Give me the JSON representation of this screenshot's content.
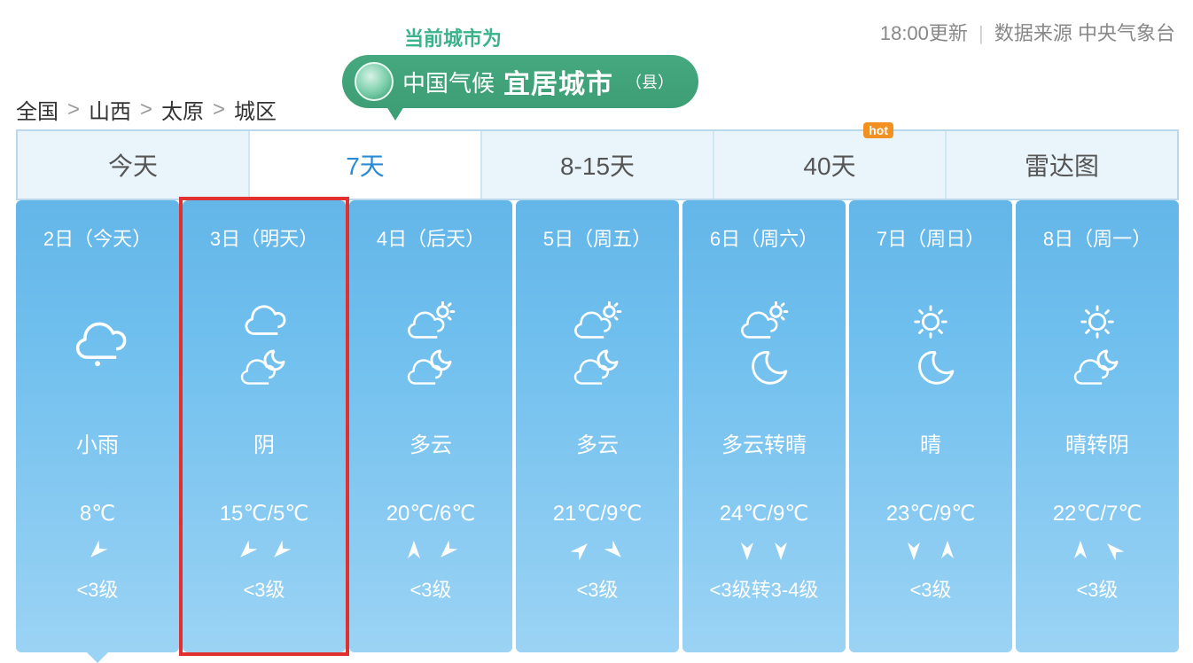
{
  "header": {
    "update_time": "18:00更新",
    "source_label": "数据来源 中央气象台"
  },
  "breadcrumb": {
    "items": [
      "全国",
      "山西",
      "太原",
      "城区"
    ]
  },
  "city_badge": {
    "caption": "当前城市为",
    "prefix": "中国气候",
    "strong": "宜居城市",
    "suffix": "（县）"
  },
  "tabs": {
    "items": [
      {
        "label": "今天",
        "active": false
      },
      {
        "label": "7天",
        "active": true
      },
      {
        "label": "8-15天",
        "active": false
      },
      {
        "label": "40天",
        "active": false,
        "hot": "hot"
      },
      {
        "label": "雷达图",
        "active": false
      }
    ]
  },
  "forecast": [
    {
      "date": "2日（今天）",
      "day_icon": "rain-light",
      "night_icon": null,
      "condition": "小雨",
      "temp": "8℃",
      "wind_arrows": [
        "sw"
      ],
      "wind": "<3级",
      "first": true
    },
    {
      "date": "3日（明天）",
      "day_icon": "overcast",
      "night_icon": "cloudy-night",
      "condition": "阴",
      "temp": "15℃/5℃",
      "wind_arrows": [
        "sw",
        "sw"
      ],
      "wind": "<3级",
      "highlighted": true
    },
    {
      "date": "4日（后天）",
      "day_icon": "cloudy-day",
      "night_icon": "cloudy-night",
      "condition": "多云",
      "temp": "20℃/6℃",
      "wind_arrows": [
        "n",
        "sw"
      ],
      "wind": "<3级"
    },
    {
      "date": "5日（周五）",
      "day_icon": "cloudy-day",
      "night_icon": "cloudy-night",
      "condition": "多云",
      "temp": "21℃/9℃",
      "wind_arrows": [
        "ne",
        "se"
      ],
      "wind": "<3级"
    },
    {
      "date": "6日（周六）",
      "day_icon": "cloudy-day",
      "night_icon": "clear-night",
      "condition": "多云转晴",
      "temp": "24℃/9℃",
      "wind_arrows": [
        "s",
        "s"
      ],
      "wind": "<3级转3-4级"
    },
    {
      "date": "7日（周日）",
      "day_icon": "sunny",
      "night_icon": "clear-night",
      "condition": "晴",
      "temp": "23℃/9℃",
      "wind_arrows": [
        "s",
        "n"
      ],
      "wind": "<3级"
    },
    {
      "date": "8日（周一）",
      "day_icon": "sunny",
      "night_icon": "cloudy-night",
      "condition": "晴转阴",
      "temp": "22℃/7℃",
      "wind_arrows": [
        "n",
        "nw"
      ],
      "wind": "<3级"
    }
  ]
}
